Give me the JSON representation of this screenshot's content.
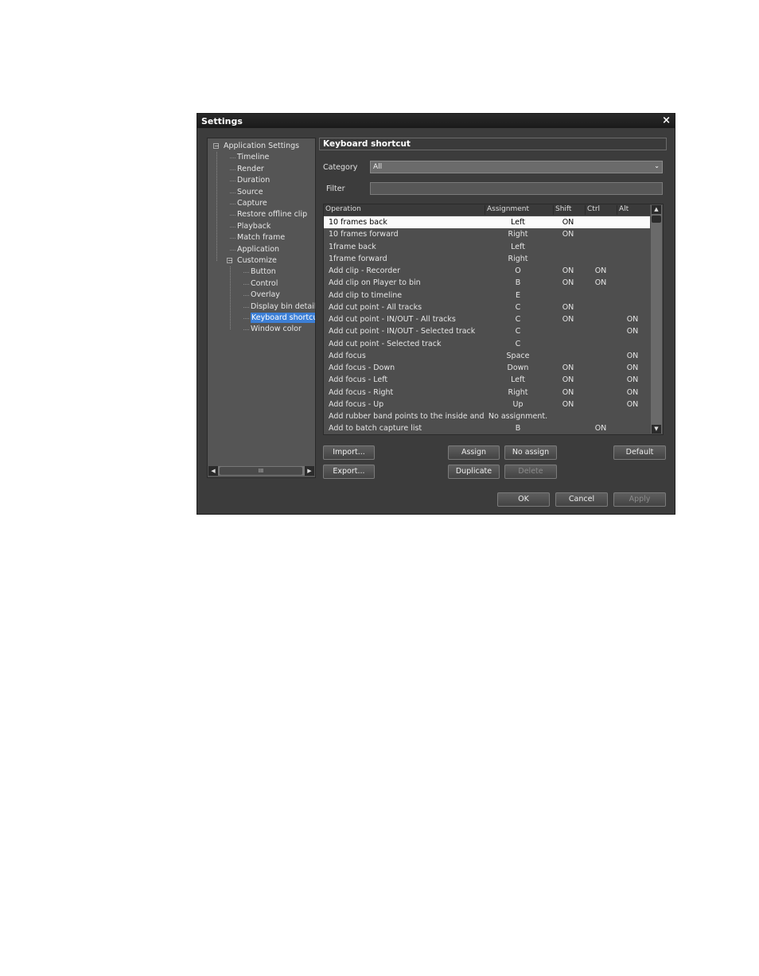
{
  "window": {
    "title": "Settings",
    "close_label": "×"
  },
  "tree": {
    "items": [
      {
        "label": "Application Settings",
        "level": 0,
        "expander": "−"
      },
      {
        "label": "Timeline",
        "level": 1
      },
      {
        "label": "Render",
        "level": 1
      },
      {
        "label": "Duration",
        "level": 1
      },
      {
        "label": "Source",
        "level": 1
      },
      {
        "label": "Capture",
        "level": 1
      },
      {
        "label": "Restore offline clip",
        "level": 1
      },
      {
        "label": "Playback",
        "level": 1
      },
      {
        "label": "Match frame",
        "level": 1
      },
      {
        "label": "Application",
        "level": 1
      },
      {
        "label": "Customize",
        "level": 1,
        "expander": "−"
      },
      {
        "label": "Button",
        "level": 2
      },
      {
        "label": "Control",
        "level": 2
      },
      {
        "label": "Overlay",
        "level": 2
      },
      {
        "label": "Display bin details",
        "level": 2
      },
      {
        "label": "Keyboard shortcut",
        "level": 2,
        "selected": true
      },
      {
        "label": "Window color",
        "level": 2
      }
    ],
    "scroll_thumb_label": "III"
  },
  "panel": {
    "title": "Keyboard shortcut",
    "category_label": "Category",
    "category_value": "All",
    "filter_label": "Filter",
    "filter_value": ""
  },
  "grid": {
    "columns": [
      "Operation",
      "Assignment",
      "Shift",
      "Ctrl",
      "Alt"
    ],
    "rows": [
      {
        "operation": "10 frames back",
        "assignment": "Left",
        "shift": "ON",
        "ctrl": "",
        "alt": "",
        "selected": true
      },
      {
        "operation": "10 frames forward",
        "assignment": "Right",
        "shift": "ON",
        "ctrl": "",
        "alt": ""
      },
      {
        "operation": "1frame back",
        "assignment": "Left",
        "shift": "",
        "ctrl": "",
        "alt": ""
      },
      {
        "operation": "1frame forward",
        "assignment": "Right",
        "shift": "",
        "ctrl": "",
        "alt": ""
      },
      {
        "operation": "Add clip - Recorder",
        "assignment": "O",
        "shift": "ON",
        "ctrl": "ON",
        "alt": ""
      },
      {
        "operation": "Add clip on Player to bin",
        "assignment": "B",
        "shift": "ON",
        "ctrl": "ON",
        "alt": ""
      },
      {
        "operation": "Add clip to timeline",
        "assignment": "E",
        "shift": "",
        "ctrl": "",
        "alt": ""
      },
      {
        "operation": "Add cut point - All tracks",
        "assignment": "C",
        "shift": "ON",
        "ctrl": "",
        "alt": ""
      },
      {
        "operation": "Add cut point - IN/OUT - All tracks",
        "assignment": "C",
        "shift": "ON",
        "ctrl": "",
        "alt": "ON"
      },
      {
        "operation": "Add cut point - IN/OUT - Selected track",
        "assignment": "C",
        "shift": "",
        "ctrl": "",
        "alt": "ON"
      },
      {
        "operation": "Add cut point - Selected track",
        "assignment": "C",
        "shift": "",
        "ctrl": "",
        "alt": ""
      },
      {
        "operation": "Add focus",
        "assignment": "Space",
        "shift": "",
        "ctrl": "",
        "alt": "ON"
      },
      {
        "operation": "Add focus - Down",
        "assignment": "Down",
        "shift": "ON",
        "ctrl": "",
        "alt": "ON"
      },
      {
        "operation": "Add focus - Left",
        "assignment": "Left",
        "shift": "ON",
        "ctrl": "",
        "alt": "ON"
      },
      {
        "operation": "Add focus - Right",
        "assignment": "Right",
        "shift": "ON",
        "ctrl": "",
        "alt": "ON"
      },
      {
        "operation": "Add focus - Up",
        "assignment": "Up",
        "shift": "ON",
        "ctrl": "",
        "alt": "ON"
      },
      {
        "operation": "Add rubber band points to the inside and ...",
        "assignment": "No assignment.",
        "shift": "",
        "ctrl": "",
        "alt": ""
      },
      {
        "operation": "Add to batch capture list",
        "assignment": "B",
        "shift": "",
        "ctrl": "ON",
        "alt": ""
      }
    ]
  },
  "buttons": {
    "import": "Import...",
    "export": "Export...",
    "assign": "Assign",
    "no_assign": "No assign",
    "duplicate": "Duplicate",
    "delete": "Delete",
    "default": "Default",
    "ok": "OK",
    "cancel": "Cancel",
    "apply": "Apply"
  }
}
